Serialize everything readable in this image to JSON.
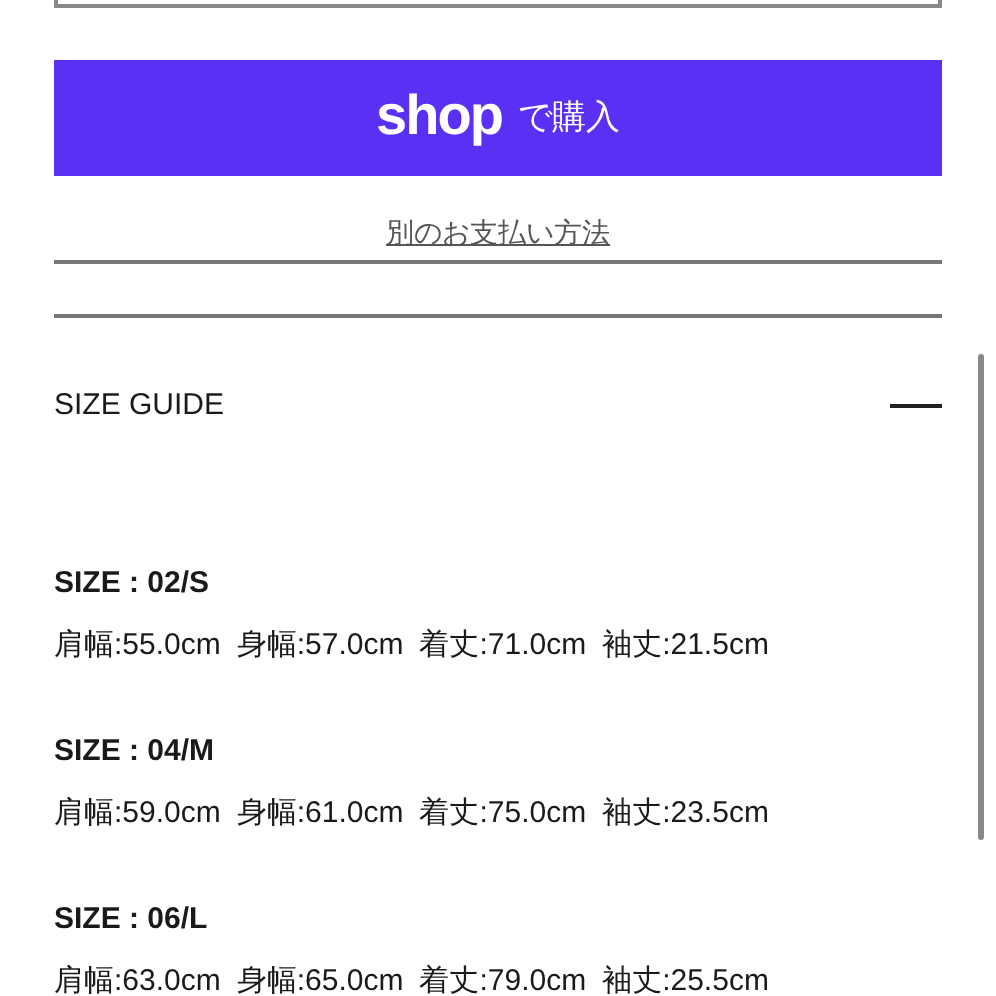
{
  "shop_pay_button": {
    "logo": "shop",
    "label": "で購入"
  },
  "other_payment_link": "別のお支払い方法",
  "size_guide": {
    "title": "SIZE GUIDE",
    "expanded": true,
    "sizes": [
      {
        "name": "SIZE : 02/S",
        "measurements": [
          "肩幅:55.0cm",
          "身幅:57.0cm",
          "着丈:71.0cm",
          "袖丈:21.5cm"
        ]
      },
      {
        "name": "SIZE : 04/M",
        "measurements": [
          "肩幅:59.0cm",
          "身幅:61.0cm",
          "着丈:75.0cm",
          "袖丈:23.5cm"
        ]
      },
      {
        "name": "SIZE : 06/L",
        "measurements": [
          "肩幅:63.0cm",
          "身幅:65.0cm",
          "着丈:79.0cm",
          "袖丈:25.5cm"
        ]
      }
    ]
  }
}
